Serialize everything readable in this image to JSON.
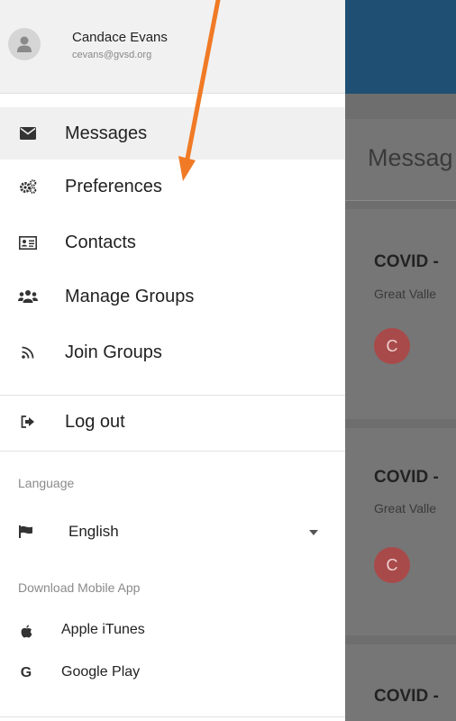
{
  "user": {
    "name": "Candace Evans",
    "email": "cevans@gvsd.org"
  },
  "nav": [
    {
      "label": "Messages",
      "icon": "envelope-icon"
    },
    {
      "label": "Preferences",
      "icon": "gears-icon"
    },
    {
      "label": "Contacts",
      "icon": "address-card-icon"
    },
    {
      "label": "Manage Groups",
      "icon": "users-icon"
    },
    {
      "label": "Join Groups",
      "icon": "rss-icon"
    }
  ],
  "logout": {
    "label": "Log out",
    "icon": "sign-out-icon"
  },
  "language": {
    "section_label": "Language",
    "selected": "English",
    "icon": "flag-icon"
  },
  "download": {
    "section_label": "Download Mobile App",
    "items": [
      {
        "label": "Apple iTunes",
        "icon": "apple-icon"
      },
      {
        "label": "Google Play",
        "icon": "google-icon"
      }
    ]
  },
  "main": {
    "page_title": "Messag",
    "cards": [
      {
        "title": "COVID -",
        "subtitle": "Great Valle",
        "avatar": "C"
      },
      {
        "title": "COVID -",
        "subtitle": "Great Valle",
        "avatar": "C"
      },
      {
        "title": "COVID -"
      }
    ]
  },
  "colors": {
    "header_bar": "#1f5073",
    "annotation_arrow": "#f07a25",
    "avatar_badge": "#a94a4a"
  }
}
